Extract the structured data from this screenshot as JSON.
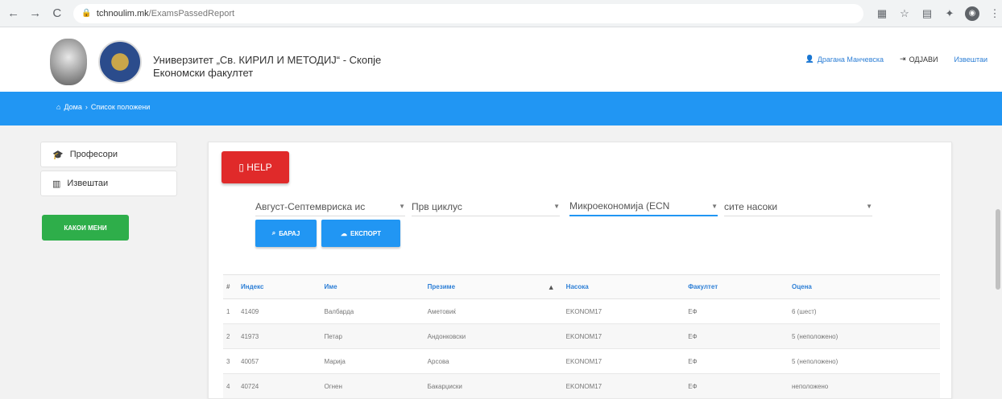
{
  "browser": {
    "url_host": "tchnoulim.mk",
    "url_path": "/ExamsPassedReport"
  },
  "header": {
    "university": "Универзитет „Св. КИРИЛ И МЕТОДИЈ“ - Скопје",
    "faculty": "Економски факултет",
    "links": [
      "Драгана Манчевска",
      "ОДЈАВИ",
      "Извештаи"
    ]
  },
  "breadcrumb": [
    "Дома",
    "Список положени"
  ],
  "sidebar": {
    "items": [
      {
        "label": "Професори",
        "icon": "graduation-cap-icon"
      },
      {
        "label": "Извештаи",
        "icon": "bar-chart-icon"
      }
    ],
    "green_button": "КАКОИ МЕНИ"
  },
  "card": {
    "help_label": "HELP",
    "filters": {
      "session": "Август-Септемвриска ис",
      "study_cycle": "Прв циклус",
      "subject": "Микроекономија (ЕСN",
      "programs": "сите насоки"
    },
    "search_label": "БАРАЈ",
    "export_label": "ЕКСПОРТ"
  },
  "table": {
    "headers": [
      "#",
      "Индекс",
      "Име",
      "Презиме",
      "Насока",
      "Факултет",
      "Оцена"
    ],
    "rows": [
      [
        "1",
        "41409",
        "Валбарда",
        "Аметовиќ",
        "EKONOM17",
        "ЕФ",
        "6 (шест)"
      ],
      [
        "2",
        "41973",
        "Петар",
        "Андонковски",
        "EKONOM17",
        "ЕФ",
        "5 (неположено)"
      ],
      [
        "3",
        "40057",
        "Марија",
        "Арсова",
        "EKONOM17",
        "ЕФ",
        "5 (неположено)"
      ],
      [
        "4",
        "40724",
        "Огнен",
        "Бакарџиски",
        "EKONOM17",
        "ЕФ",
        "неположено"
      ]
    ]
  },
  "colors": {
    "accent": "#2196f3",
    "help": "#e02a2a",
    "green": "#2eae4a"
  }
}
